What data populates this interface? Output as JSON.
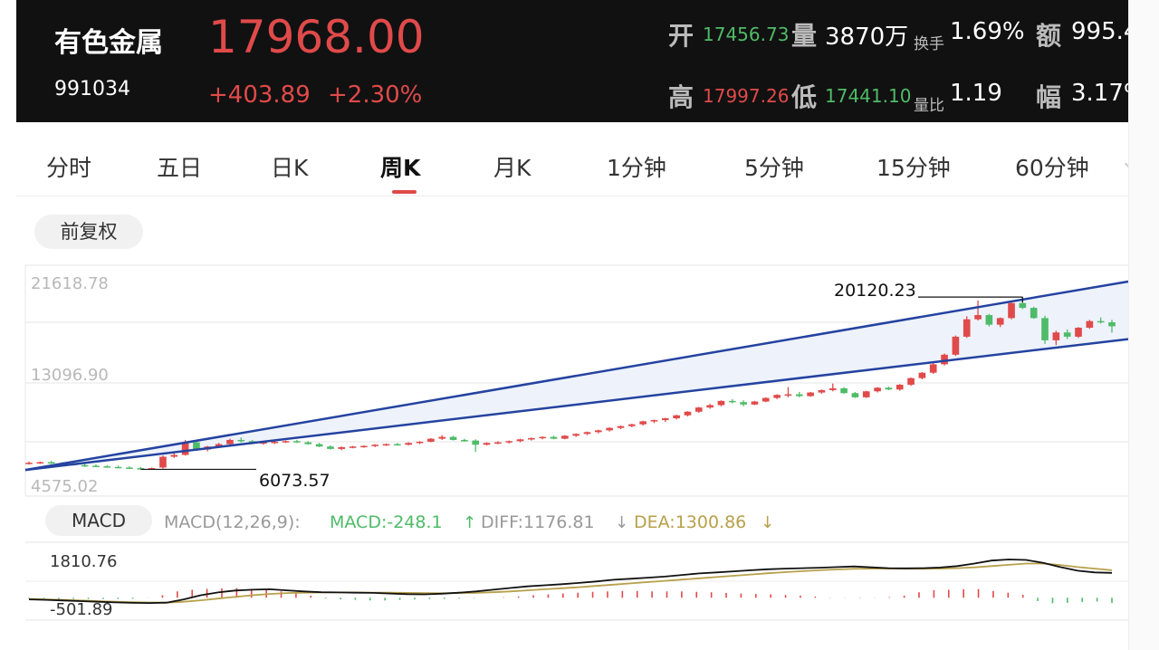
{
  "quote": {
    "name": "有色金属",
    "code": "991034",
    "price": "17968.00",
    "change": "+403.89",
    "change_pct": "+2.30%"
  },
  "stats": {
    "open_label": "开",
    "open_value": "17456.73",
    "volume_label": "量",
    "volume_value": "3870万",
    "turnover_label": "换手",
    "turnover_value": "1.69%",
    "amount_label": "额",
    "amount_value": "995.4",
    "high_label": "高",
    "high_value": "17997.26",
    "low_label": "低",
    "low_value": "17441.10",
    "vol_ratio_label": "量比",
    "vol_ratio_value": "1.19",
    "amplitude_label": "幅",
    "amplitude_value": "3.17%"
  },
  "tabs": [
    {
      "label": "分时"
    },
    {
      "label": "五日"
    },
    {
      "label": "日K"
    },
    {
      "label": "周K",
      "active": true
    },
    {
      "label": "月K"
    },
    {
      "label": "1分钟"
    },
    {
      "label": "5分钟"
    },
    {
      "label": "15分钟"
    },
    {
      "label": "60分钟"
    }
  ],
  "adjust_button": "前复权",
  "macd": {
    "tag": "MACD",
    "params": "MACD(12,26,9):",
    "macd_text": "MACD:-248.1",
    "diff_text": "DIFF:1176.81",
    "dea_text": "DEA:1300.86",
    "axis_top": "1810.76",
    "axis_bottom": "-501.89"
  },
  "colors": {
    "up": "#e04a4a",
    "down": "#4fbb68",
    "channel": "#2443a0",
    "channel_fill": "#eef2fb",
    "diff_line": "#111111",
    "dea_line": "#b8a04a",
    "dea_text": "#b8a04a",
    "macd_text": "#4fbb68"
  },
  "chart_data": [
    {
      "type": "candlestick",
      "title": "",
      "y_axis_labels": [
        "21618.78",
        "13096.90",
        "4575.02"
      ],
      "ylim": [
        4575.02,
        21618.78
      ],
      "annotations": [
        {
          "text": "20120.23",
          "value": 20120.23,
          "note": "period high"
        },
        {
          "text": "6073.57",
          "value": 6073.57,
          "note": "period low"
        }
      ],
      "channel_lines": [
        {
          "name": "upper",
          "start": 6000,
          "end": 21700
        },
        {
          "name": "lower",
          "start": 6000,
          "end": 16900
        }
      ],
      "ohlc": [
        [
          6550,
          6700,
          6450,
          6600
        ],
        [
          6600,
          6700,
          6500,
          6650
        ],
        [
          6650,
          6750,
          6500,
          6550
        ],
        [
          6550,
          6650,
          6400,
          6500
        ],
        [
          6500,
          6600,
          6350,
          6400
        ],
        [
          6400,
          6500,
          6250,
          6350
        ],
        [
          6350,
          6450,
          6250,
          6300
        ],
        [
          6300,
          6400,
          6200,
          6250
        ],
        [
          6250,
          6350,
          6150,
          6200
        ],
        [
          6200,
          6300,
          6100,
          6150
        ],
        [
          6150,
          6250,
          6050,
          6100
        ],
        [
          6100,
          6200,
          6073.57,
          6150
        ],
        [
          6200,
          7200,
          6100,
          7100
        ],
        [
          7100,
          7400,
          7000,
          7250
        ],
        [
          7250,
          8500,
          7200,
          8300
        ],
        [
          8300,
          8400,
          7600,
          7700
        ],
        [
          7700,
          8000,
          7550,
          7950
        ],
        [
          7950,
          8250,
          7850,
          8150
        ],
        [
          8150,
          8600,
          8050,
          8500
        ],
        [
          8500,
          8700,
          8300,
          8400
        ],
        [
          8400,
          8500,
          8150,
          8250
        ],
        [
          8250,
          8400,
          8100,
          8300
        ],
        [
          8300,
          8400,
          8150,
          8350
        ],
        [
          8350,
          8450,
          8250,
          8400
        ],
        [
          8400,
          8500,
          8250,
          8300
        ],
        [
          8300,
          8400,
          8100,
          8150
        ],
        [
          8150,
          8250,
          7900,
          7950
        ],
        [
          7950,
          8050,
          7700,
          7750
        ],
        [
          7750,
          7950,
          7650,
          7900
        ],
        [
          7900,
          8000,
          7800,
          7950
        ],
        [
          7950,
          8050,
          7850,
          8000
        ],
        [
          8000,
          8150,
          7900,
          8100
        ],
        [
          8100,
          8200,
          8000,
          8150
        ],
        [
          8150,
          8250,
          8050,
          8100
        ],
        [
          8100,
          8300,
          8050,
          8250
        ],
        [
          8250,
          8400,
          8150,
          8350
        ],
        [
          8350,
          8650,
          8300,
          8600
        ],
        [
          8600,
          8900,
          8500,
          8750
        ],
        [
          8750,
          8850,
          8450,
          8500
        ],
        [
          8500,
          8600,
          8350,
          8450
        ],
        [
          8450,
          8550,
          7500,
          8100
        ],
        [
          8100,
          8300,
          8050,
          8250
        ],
        [
          8250,
          8400,
          8150,
          8300
        ],
        [
          8300,
          8450,
          8200,
          8400
        ],
        [
          8400,
          8600,
          8300,
          8550
        ],
        [
          8550,
          8700,
          8450,
          8650
        ],
        [
          8650,
          8800,
          8550,
          8750
        ],
        [
          8750,
          8850,
          8550,
          8600
        ],
        [
          8600,
          8900,
          8550,
          8850
        ],
        [
          8850,
          9050,
          8750,
          9000
        ],
        [
          9000,
          9200,
          8900,
          9150
        ],
        [
          9150,
          9350,
          9050,
          9300
        ],
        [
          9300,
          9550,
          9200,
          9500
        ],
        [
          9500,
          9700,
          9400,
          9650
        ],
        [
          9650,
          9850,
          9550,
          9800
        ],
        [
          9800,
          10100,
          9700,
          10050
        ],
        [
          10050,
          10200,
          9900,
          10150
        ],
        [
          10150,
          10350,
          10000,
          10300
        ],
        [
          10300,
          10600,
          10200,
          10550
        ],
        [
          10550,
          10900,
          10450,
          10850
        ],
        [
          10850,
          11250,
          10750,
          11200
        ],
        [
          11200,
          11500,
          11100,
          11400
        ],
        [
          11400,
          11800,
          11300,
          11750
        ],
        [
          11750,
          11900,
          11550,
          11650
        ],
        [
          11650,
          11800,
          11300,
          11450
        ],
        [
          11450,
          11750,
          11400,
          11700
        ],
        [
          11700,
          12050,
          11650,
          12000
        ],
        [
          12000,
          12300,
          11900,
          12250
        ],
        [
          12250,
          12900,
          12050,
          12300
        ],
        [
          12300,
          12500,
          12050,
          12150
        ],
        [
          12150,
          12500,
          12100,
          12450
        ],
        [
          12450,
          12700,
          12350,
          12650
        ],
        [
          12650,
          13200,
          12550,
          12800
        ],
        [
          12800,
          12900,
          12350,
          12400
        ],
        [
          12400,
          12500,
          12000,
          12050
        ],
        [
          12050,
          12600,
          12000,
          12550
        ],
        [
          12550,
          12900,
          12450,
          12850
        ],
        [
          12850,
          12950,
          12650,
          12700
        ],
        [
          12700,
          13150,
          12600,
          13100
        ],
        [
          13100,
          13700,
          13000,
          13650
        ],
        [
          13650,
          14150,
          13550,
          14100
        ],
        [
          14100,
          14900,
          14000,
          14800
        ],
        [
          14800,
          15700,
          14700,
          15600
        ],
        [
          15600,
          17200,
          15500,
          17100
        ],
        [
          17100,
          18800,
          17000,
          18550
        ],
        [
          18550,
          20120.23,
          18450,
          18900
        ],
        [
          18900,
          19000,
          17950,
          18100
        ],
        [
          18100,
          18700,
          17900,
          18650
        ],
        [
          18650,
          20100,
          18550,
          19900
        ],
        [
          19900,
          20400,
          19400,
          19500
        ],
        [
          19500,
          19600,
          18600,
          18650
        ],
        [
          18650,
          18850,
          16500,
          16800
        ],
        [
          16800,
          17600,
          16400,
          17450
        ],
        [
          17450,
          17700,
          16900,
          17100
        ],
        [
          17100,
          17900,
          17000,
          17850
        ],
        [
          17850,
          18500,
          17750,
          18400
        ],
        [
          18400,
          18700,
          18200,
          18300
        ],
        [
          18300,
          18500,
          17441.1,
          17968
        ]
      ]
    },
    {
      "type": "line",
      "title": "MACD(12,26,9)",
      "ylim": [
        -501.89,
        1810.76
      ],
      "series": [
        {
          "name": "DIFF",
          "values": [
            -80,
            -100,
            -130,
            -160,
            -190,
            -220,
            -240,
            -250,
            -230,
            -80,
            120,
            250,
            340,
            380,
            400,
            350,
            300,
            260,
            250,
            240,
            230,
            200,
            170,
            160,
            190,
            240,
            300,
            380,
            460,
            540,
            590,
            640,
            700,
            770,
            850,
            900,
            950,
            1000,
            1080,
            1150,
            1200,
            1250,
            1300,
            1350,
            1380,
            1400,
            1420,
            1450,
            1480,
            1440,
            1400,
            1390,
            1400,
            1430,
            1500,
            1620,
            1760,
            1810,
            1790,
            1650,
            1450,
            1280,
            1200,
            1176.81
          ]
        },
        {
          "name": "DEA",
          "values": [
            -60,
            -80,
            -100,
            -130,
            -160,
            -190,
            -210,
            -225,
            -230,
            -190,
            -120,
            -40,
            40,
            120,
            180,
            220,
            240,
            250,
            250,
            250,
            245,
            240,
            230,
            220,
            215,
            220,
            230,
            260,
            300,
            350,
            400,
            450,
            500,
            560,
            620,
            680,
            740,
            800,
            860,
            920,
            980,
            1040,
            1100,
            1160,
            1210,
            1260,
            1300,
            1340,
            1370,
            1380,
            1380,
            1375,
            1375,
            1380,
            1400,
            1440,
            1500,
            1560,
            1620,
            1620,
            1550,
            1450,
            1380,
            1300.86
          ]
        }
      ],
      "histogram": [
        -40,
        -40,
        -60,
        -60,
        -60,
        -60,
        -60,
        -50,
        -10,
        120,
        300,
        380,
        420,
        440,
        460,
        420,
        360,
        300,
        200,
        100,
        -40,
        -80,
        -100,
        -130,
        -130,
        -100,
        -80,
        -60,
        -60,
        -40,
        -20,
        0,
        20,
        60,
        120,
        160,
        200,
        240,
        280,
        300,
        320,
        320,
        300,
        300,
        300,
        280,
        260,
        230,
        200,
        180,
        160,
        130,
        100,
        60,
        10,
        -10,
        -20,
        -10,
        30,
        100,
        260,
        360,
        380,
        400,
        410,
        320,
        240,
        140,
        -160,
        -260,
        -240,
        -200,
        -180,
        -248.1
      ],
      "axis_labels": [
        "1810.76",
        "-501.89"
      ]
    }
  ]
}
